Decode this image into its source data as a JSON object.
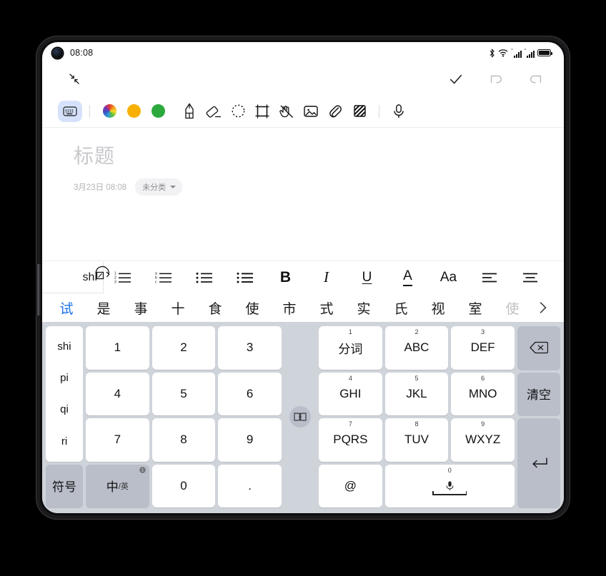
{
  "status_bar": {
    "time": "08:08",
    "icons": [
      "bluetooth-icon",
      "wifi-icon",
      "signal-icon-1",
      "signal-icon-2",
      "battery-icon"
    ],
    "signal_superscript": "“"
  },
  "header": {
    "collapse_icon": "collapse-arrows-icon",
    "confirm_icon": "check-icon",
    "undo_icon": "undo-icon",
    "redo_icon": "redo-icon"
  },
  "toolbar": {
    "items": [
      {
        "name": "keyboard-tool",
        "icon": "keyboard-icon",
        "selected": true
      },
      {
        "name": "color-wheel-tool",
        "icon": "color-wheel-icon",
        "color": "#e23b2e"
      },
      {
        "name": "color-amber-tool",
        "icon": "circle-icon",
        "color": "#f7b000"
      },
      {
        "name": "color-green-tool",
        "icon": "circle-icon",
        "color": "#2ca93c"
      },
      {
        "name": "pencil-tool",
        "icon": "pencil-icon"
      },
      {
        "name": "eraser-tool",
        "icon": "eraser-icon"
      },
      {
        "name": "lasso-select-tool",
        "icon": "lasso-dashed-circle-icon"
      },
      {
        "name": "crop-tool",
        "icon": "crop-frame-icon"
      },
      {
        "name": "palm-rejection-tool",
        "icon": "hand-off-icon"
      },
      {
        "name": "insert-image-tool",
        "icon": "image-icon"
      },
      {
        "name": "attachment-tool",
        "icon": "paperclip-icon"
      },
      {
        "name": "shading-tool",
        "icon": "striped-square-icon"
      },
      {
        "name": "voice-record-tool",
        "icon": "microphone-icon"
      }
    ]
  },
  "note": {
    "title_placeholder": "标题",
    "date": "3月23日 08:08",
    "category": "未分类"
  },
  "format_bar": {
    "items": [
      {
        "name": "ordered-list-number",
        "icon": "list-numbered-icon"
      },
      {
        "name": "ordered-list-letter",
        "icon": "list-lettered-icon"
      },
      {
        "name": "bullet-list",
        "icon": "list-bullet-icon"
      },
      {
        "name": "bullet-list-dense",
        "icon": "list-bullet-dense-icon"
      },
      {
        "name": "bold",
        "label": "B"
      },
      {
        "name": "italic",
        "label": "I"
      },
      {
        "name": "underline",
        "label": "U"
      },
      {
        "name": "font-color",
        "label": "A"
      },
      {
        "name": "font-size",
        "label": "Aa"
      },
      {
        "name": "align-left",
        "icon": "align-left-icon"
      },
      {
        "name": "align-center",
        "icon": "align-center-icon"
      },
      {
        "name": "align-right",
        "icon": "align-right-icon"
      }
    ]
  },
  "compose": {
    "text": "shi",
    "badge_icon": "handwriting-rotate-icon"
  },
  "candidates": {
    "items": [
      {
        "text": "试",
        "state": "selected"
      },
      {
        "text": "是",
        "state": "normal"
      },
      {
        "text": "事",
        "state": "normal"
      },
      {
        "text": "十",
        "state": "normal"
      },
      {
        "text": "食",
        "state": "normal"
      },
      {
        "text": "使",
        "state": "normal"
      },
      {
        "text": "市",
        "state": "normal"
      },
      {
        "text": "式",
        "state": "normal"
      },
      {
        "text": "实",
        "state": "normal"
      },
      {
        "text": "氏",
        "state": "normal"
      },
      {
        "text": "视",
        "state": "normal"
      },
      {
        "text": "室",
        "state": "normal"
      },
      {
        "text": "使",
        "state": "dim"
      }
    ],
    "more_icon": "chevron-right-icon"
  },
  "keyboard": {
    "pinyin_suggestions": [
      "shi",
      "pi",
      "qi",
      "ri"
    ],
    "symbol_key": "符号",
    "lang_key_main": "中",
    "lang_key_sub": "/英",
    "lang_key_badge": "globe-icon",
    "num_0": "0",
    "num_dot": ".",
    "numpad": [
      {
        "label": "1"
      },
      {
        "label": "2"
      },
      {
        "label": "3"
      },
      {
        "label": "4"
      },
      {
        "label": "5"
      },
      {
        "label": "6"
      },
      {
        "label": "7"
      },
      {
        "label": "8"
      },
      {
        "label": "9"
      }
    ],
    "t9": [
      {
        "sup": "1",
        "label": "分词"
      },
      {
        "sup": "2",
        "label": "ABC"
      },
      {
        "sup": "3",
        "label": "DEF"
      },
      {
        "sup": "4",
        "label": "GHI"
      },
      {
        "sup": "5",
        "label": "JKL"
      },
      {
        "sup": "6",
        "label": "MNO"
      },
      {
        "sup": "7",
        "label": "PQRS"
      },
      {
        "sup": "8",
        "label": "TUV"
      },
      {
        "sup": "9",
        "label": "WXYZ"
      }
    ],
    "at_key": "@",
    "space_sup": "0",
    "space_icon": "microphone-icon",
    "backspace_icon": "backspace-icon",
    "clear_key": "清空",
    "enter_icon": "enter-arrow-icon",
    "resize_handle_icon": "split-keyboard-icon"
  },
  "colors": {
    "accent_blue": "#1a73e8",
    "keyboard_bg": "#cfd3da",
    "fn_key": "#b9bec9",
    "tool_selected_bg": "#d6e2fb"
  }
}
